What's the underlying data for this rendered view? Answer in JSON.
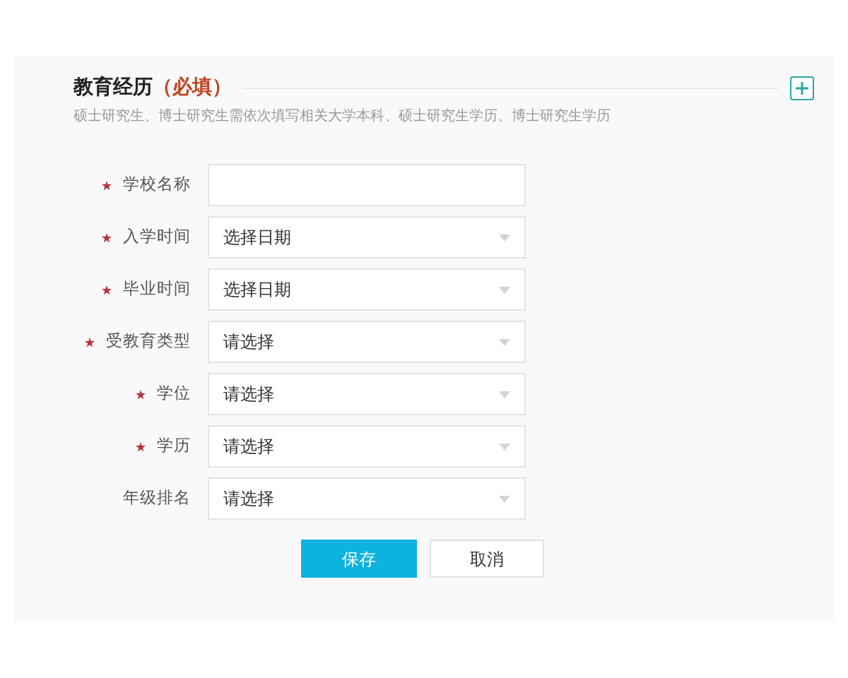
{
  "section": {
    "title": "教育经历",
    "required_note": "（必填）",
    "hint": "硕士研究生、博士研究生需依次填写相关大学本科、硕士研究生学历、博士研究生学历"
  },
  "fields": [
    {
      "label": "学校名称",
      "required": true,
      "kind": "text"
    },
    {
      "label": "入学时间",
      "required": true,
      "kind": "select",
      "placeholder": "选择日期"
    },
    {
      "label": "毕业时间",
      "required": true,
      "kind": "select",
      "placeholder": "选择日期"
    },
    {
      "label": "受教育类型",
      "required": true,
      "kind": "select",
      "placeholder": "请选择"
    },
    {
      "label": "学位",
      "required": true,
      "kind": "select",
      "placeholder": "请选择"
    },
    {
      "label": "学历",
      "required": true,
      "kind": "select",
      "placeholder": "请选择"
    },
    {
      "label": "年级排名",
      "required": false,
      "kind": "select",
      "placeholder": "请选择"
    }
  ],
  "buttons": [
    {
      "label": "保存",
      "kind": "primary"
    },
    {
      "label": "取消",
      "kind": "secondary"
    }
  ]
}
